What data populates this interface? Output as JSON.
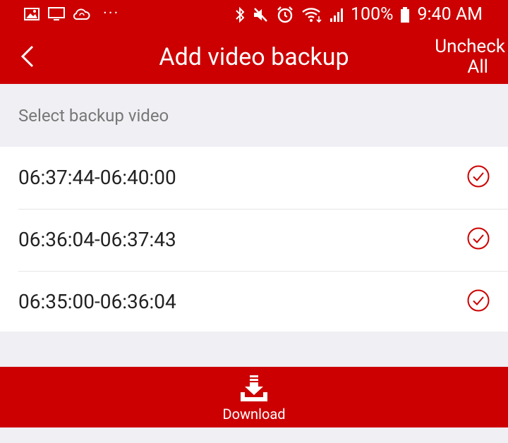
{
  "status_bar": {
    "battery": "100%",
    "time": "9:40 AM",
    "overflow": "···"
  },
  "header": {
    "title": "Add video backup",
    "uncheck_all_line1": "Uncheck",
    "uncheck_all_line2": "All"
  },
  "section_label": "Select backup video",
  "videos": [
    {
      "label": "06:37:44-06:40:00",
      "checked": true
    },
    {
      "label": "06:36:04-06:37:43",
      "checked": true
    },
    {
      "label": "06:35:00-06:36:04",
      "checked": true
    }
  ],
  "download": {
    "label": "Download"
  },
  "colors": {
    "brand": "#cc0000",
    "background": "#efeff4",
    "check": "#cc0000"
  },
  "icons": [
    "image-icon",
    "monitor-icon",
    "cloud-sync-icon",
    "bluetooth-icon",
    "mute-icon",
    "alarm-icon",
    "wifi-icon",
    "signal-icon",
    "battery-icon",
    "back-chevron-icon",
    "check-circle-icon",
    "download-icon"
  ]
}
